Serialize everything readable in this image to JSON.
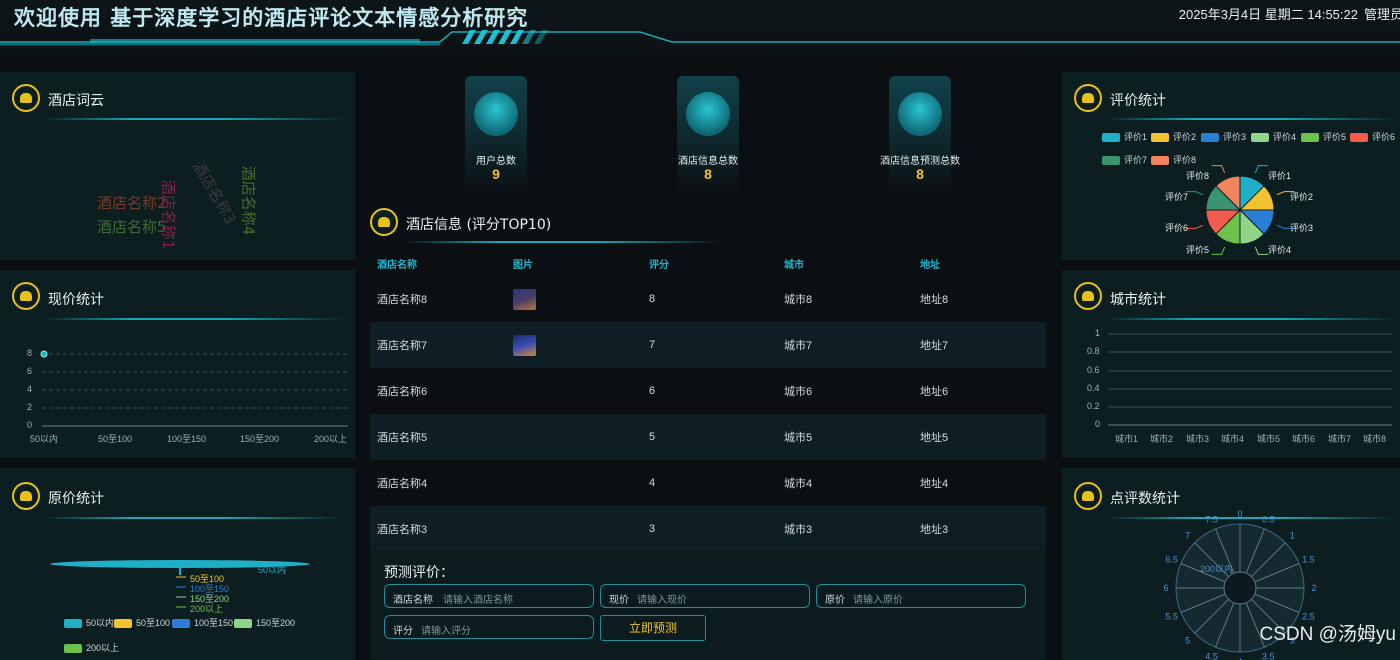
{
  "header": {
    "title": "欢迎使用 基于深度学习的酒店评论文本情感分析研究",
    "datetime": "2025年3月4日 星期二 14:55:22",
    "user_link": "管理员"
  },
  "wordcloud_panel": {
    "title": "酒店词云",
    "words": [
      {
        "text": "酒店名称2",
        "color": "#7a3a2a"
      },
      {
        "text": "酒店名称5",
        "color": "#3f6b36"
      },
      {
        "text": "酒店名称1",
        "color": "#8a1f4a"
      },
      {
        "text": "酒店名称3",
        "color": "#3a3a3a"
      },
      {
        "text": "酒店名称4",
        "color": "#4f6a2a"
      }
    ]
  },
  "current_price_panel": {
    "title": "现价统计",
    "chart_data": {
      "type": "line",
      "categories": [
        "50以内",
        "50至100",
        "100至150",
        "150至200",
        "200以上"
      ],
      "values": [
        8,
        0,
        0,
        0,
        0
      ],
      "yticks": [
        "0",
        "2",
        "4",
        "6",
        "8"
      ],
      "ylim": [
        0,
        8
      ]
    }
  },
  "original_price_panel": {
    "title": "原价统计",
    "chart_data": {
      "type": "pie",
      "labels": [
        "50以内",
        "50至100",
        "100至150",
        "150至200",
        "200以上"
      ],
      "values": [
        8,
        0,
        0,
        0,
        0
      ],
      "colors": [
        "#1fb0c9",
        "#f2c230",
        "#2a7fd4",
        "#8ed58a",
        "#6cc24a"
      ],
      "callouts": [
        "50以内",
        "50至100",
        "100至150",
        "150至200",
        "200以上"
      ]
    }
  },
  "stats": [
    {
      "label": "用户总数",
      "value": "9",
      "icon": "add-user-icon"
    },
    {
      "label": "酒店信息总数",
      "value": "8",
      "icon": "dna-icon"
    },
    {
      "label": "酒店信息预测总数",
      "value": "8",
      "icon": "user-icon"
    }
  ],
  "hotel_table": {
    "title": "酒店信息 (评分TOP10)",
    "columns": [
      "酒店名称",
      "图片",
      "评分",
      "城市",
      "地址"
    ],
    "rows": [
      {
        "name": "酒店名称8",
        "has_image": true,
        "score": "8",
        "city": "城市8",
        "address": "地址8"
      },
      {
        "name": "酒店名称7",
        "has_image": true,
        "score": "7",
        "city": "城市7",
        "address": "地址7"
      },
      {
        "name": "酒店名称6",
        "has_image": false,
        "score": "6",
        "city": "城市6",
        "address": "地址6"
      },
      {
        "name": "酒店名称5",
        "has_image": false,
        "score": "5",
        "city": "城市5",
        "address": "地址5"
      },
      {
        "name": "酒店名称4",
        "has_image": false,
        "score": "4",
        "city": "城市4",
        "address": "地址4"
      },
      {
        "name": "酒店名称3",
        "has_image": false,
        "score": "3",
        "city": "城市3",
        "address": "地址3"
      }
    ]
  },
  "predict_form": {
    "title": "预测评价：",
    "fields": [
      {
        "label": "酒店名称",
        "placeholder": "请输入酒店名称"
      },
      {
        "label": "现价",
        "placeholder": "请输入现价"
      },
      {
        "label": "原价",
        "placeholder": "请输入原价"
      },
      {
        "label": "评分",
        "placeholder": "请输入评分"
      }
    ],
    "submit_label": "立即预测"
  },
  "rating_panel": {
    "title": "评价统计",
    "chart_data": {
      "type": "pie",
      "labels": [
        "评价1",
        "评价2",
        "评价3",
        "评价4",
        "评价5",
        "评价6",
        "评价7",
        "评价8"
      ],
      "values": [
        1,
        1,
        1,
        1,
        1,
        1,
        1,
        1
      ],
      "colors": [
        "#1fb0c9",
        "#f2c230",
        "#2a7fd4",
        "#8ed58a",
        "#6cc24a",
        "#f25c4c",
        "#3a9470",
        "#f2845c"
      ]
    }
  },
  "city_panel": {
    "title": "城市统计",
    "chart_data": {
      "type": "line",
      "categories": [
        "城市1",
        "城市2",
        "城市3",
        "城市4",
        "城市5",
        "城市6",
        "城市7",
        "城市8"
      ],
      "values": [
        0,
        0,
        0,
        0,
        0,
        0,
        0,
        0
      ],
      "yticks": [
        "0",
        "0.2",
        "0.4",
        "0.6",
        "0.8",
        "1"
      ],
      "ylim": [
        0,
        1
      ]
    }
  },
  "review_count_panel": {
    "title": "点评数统计",
    "chart_data": {
      "type": "polar-bar",
      "angle_ticks": [
        "0",
        "0.5",
        "1",
        "1.5",
        "2",
        "2.5",
        "3",
        "3.5",
        "4",
        "4.5",
        "5",
        "5.5",
        "6",
        "6.5",
        "7",
        "7.5"
      ],
      "radius_label": "200以内"
    }
  },
  "watermark": "CSDN @汤姆yu"
}
